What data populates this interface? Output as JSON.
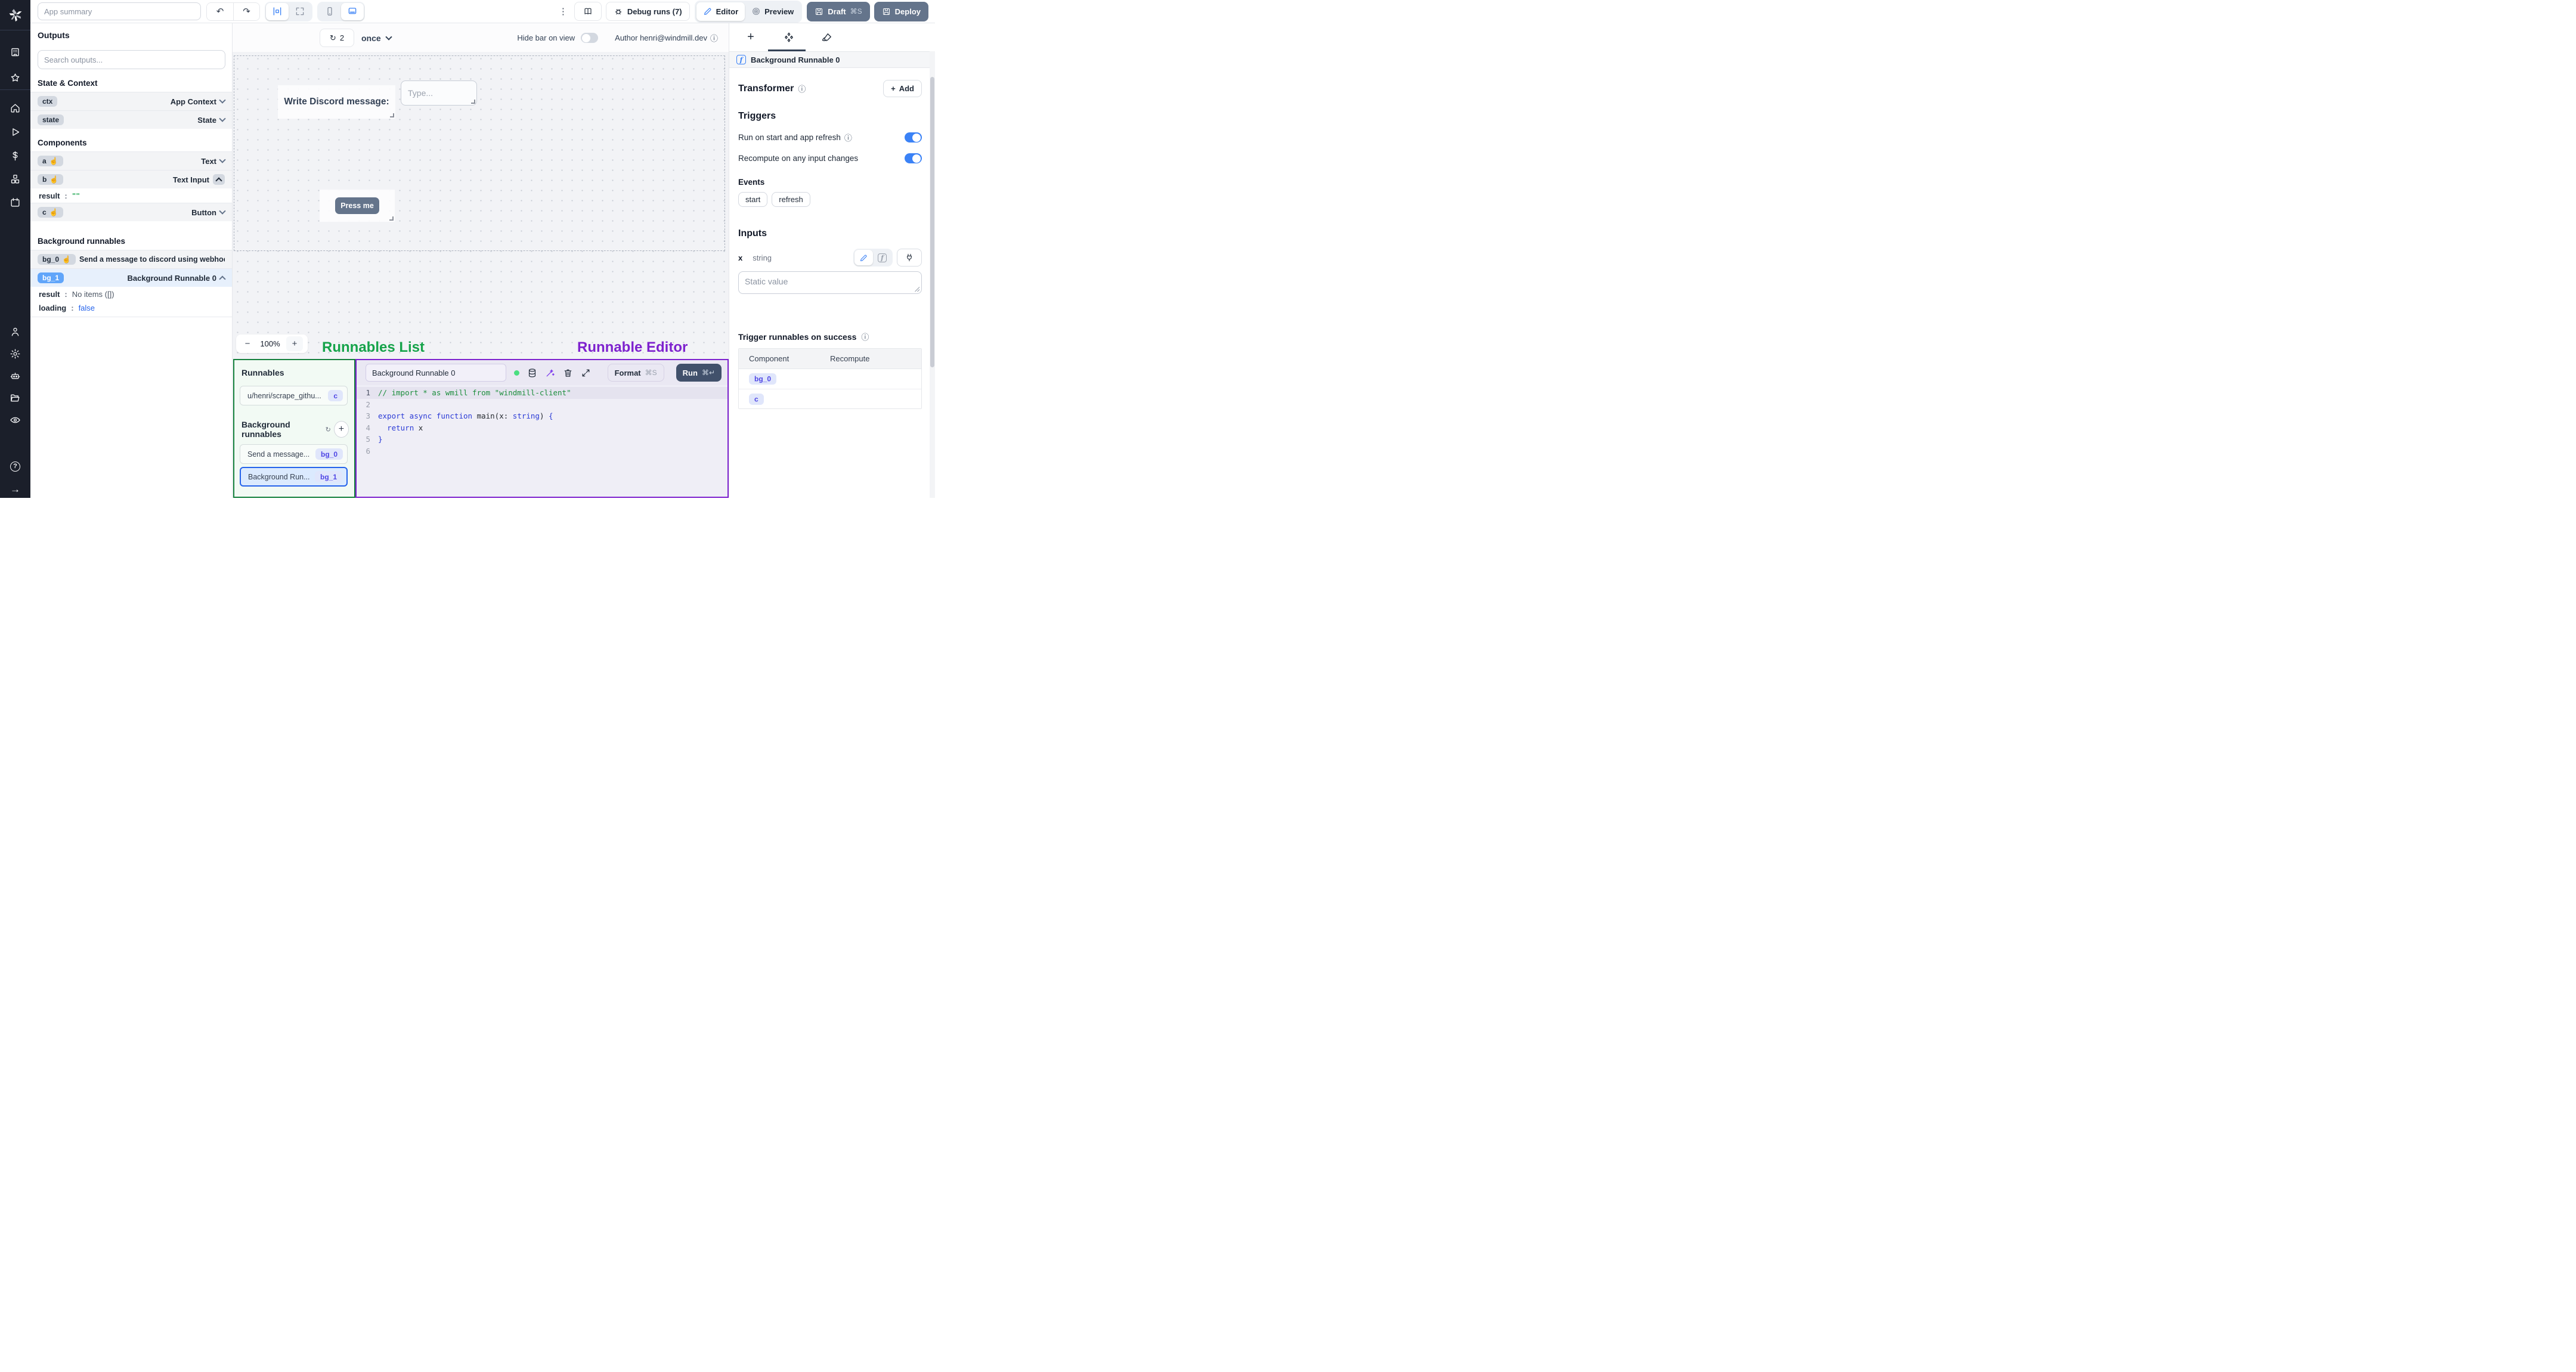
{
  "colors": {
    "accent": "#3b82f6",
    "green": "#16a34a",
    "purple": "#7e22ce",
    "slate": "#64748b"
  },
  "icons": {
    "kebab": "⋮",
    "undo": "↶",
    "redo": "↷",
    "info": "ⓘ",
    "hand": "☝",
    "plus": "+",
    "minus": "−",
    "refresh": "↻",
    "question": "?",
    "arrow_right": "→",
    "function": "f"
  },
  "topbar": {
    "app_summary_placeholder": "App summary",
    "debug_runs": "Debug runs (7)",
    "editor": "Editor",
    "preview": "Preview",
    "draft": "Draft",
    "draft_shortcut": "⌘S",
    "deploy": "Deploy"
  },
  "outputs": {
    "title": "Outputs",
    "search_placeholder": "Search outputs...",
    "state_context_title": "State & Context",
    "ctx": {
      "key": "ctx",
      "type": "App Context"
    },
    "state": {
      "key": "state",
      "type": "State"
    },
    "components_title": "Components",
    "a": {
      "key": "a",
      "type": "Text"
    },
    "b": {
      "key": "b",
      "type": "Text Input"
    },
    "b_result": {
      "key": "result",
      "value": "\"\""
    },
    "c": {
      "key": "c",
      "type": "Button"
    },
    "bg_title": "Background runnables",
    "bg0": {
      "key": "bg_0",
      "label": "Send a message to discord using webhoo"
    },
    "bg1": {
      "key": "bg_1",
      "label": "Background Runnable 0"
    },
    "bg1_result": {
      "key": "result",
      "value": "No items ([])"
    },
    "bg1_loading": {
      "key": "loading",
      "value": "false"
    }
  },
  "canvas": {
    "refresh_count": "2",
    "frequency": "once",
    "hide_bar_label": "Hide bar on view",
    "author": "Author henri@windmill.dev",
    "text_component": "Write Discord message:",
    "input_placeholder": "Type...",
    "button_label": "Press me",
    "zoom": "100%"
  },
  "annotations": {
    "runnables_list": "Runnables List",
    "runnable_editor": "Runnable Editor"
  },
  "runnables_panel": {
    "title": "Runnables",
    "item1": {
      "label": "u/henri/scrape_githu...",
      "badge": "c"
    },
    "bg_title": "Background runnables",
    "item2": {
      "label": "Send a message...",
      "badge": "bg_0"
    },
    "item3": {
      "label": "Background Run...",
      "badge": "bg_1"
    }
  },
  "editor": {
    "name": "Background Runnable 0",
    "format": "Format",
    "format_shortcut": "⌘S",
    "run": "Run",
    "run_shortcut": "⌘↵",
    "code": {
      "lines": [
        [
          {
            "t": "// import * as wmill from \"windmill-client\"",
            "c": "cm"
          }
        ],
        [],
        [
          {
            "t": "export async function ",
            "c": "kw"
          },
          {
            "t": "main(x",
            "c": "tx"
          },
          {
            "t": ": ",
            "c": "tx"
          },
          {
            "t": "string",
            "c": "kw"
          },
          {
            "t": ") ",
            "c": "tx"
          },
          {
            "t": "{",
            "c": "kw"
          }
        ],
        [
          {
            "t": "  ",
            "c": "tx"
          },
          {
            "t": "return",
            "c": "kw"
          },
          {
            "t": " x",
            "c": "tx"
          }
        ],
        [
          {
            "t": "}",
            "c": "kw"
          }
        ],
        []
      ]
    }
  },
  "right_panel": {
    "header": "Background Runnable 0",
    "transformer": "Transformer",
    "add": "Add",
    "triggers": "Triggers",
    "trigger1": "Run on start and app refresh",
    "trigger2": "Recompute on any input changes",
    "events": "Events",
    "event_badges": [
      "start",
      "refresh"
    ],
    "inputs": "Inputs",
    "input_name": "x",
    "input_type": "string",
    "static_placeholder": "Static value",
    "on_success": "Trigger runnables on success",
    "table": {
      "headers": [
        "Component",
        "Recompute"
      ],
      "rows": [
        {
          "component": "bg_0"
        },
        {
          "component": "c"
        }
      ]
    }
  }
}
